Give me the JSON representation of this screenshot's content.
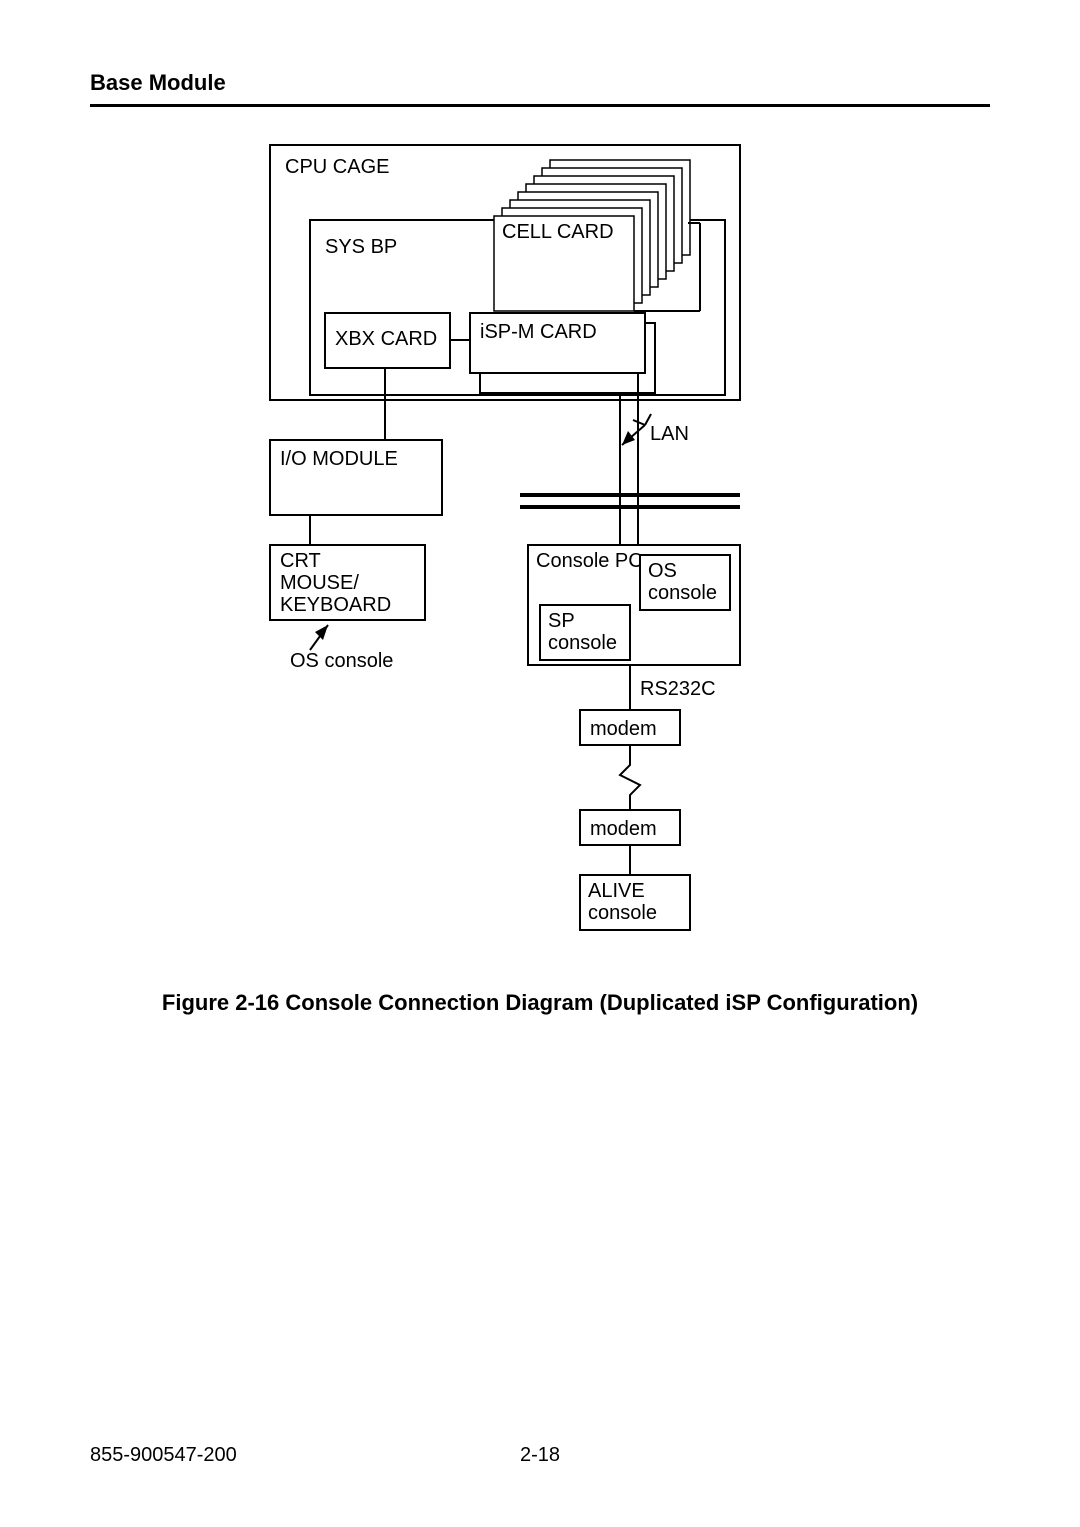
{
  "header": {
    "title": "Base Module"
  },
  "diagram": {
    "labels": {
      "cpu_cage": "CPU CAGE",
      "sys_bp": "SYS BP",
      "cell_card": "CELL CARD",
      "xbx_card": "XBX CARD",
      "isp_m_card": "iSP-M CARD",
      "io_module": "I/O MODULE",
      "lan": "LAN",
      "crt_l1": "CRT",
      "crt_l2": "MOUSE/",
      "crt_l3": "KEYBOARD",
      "os_console_note": "OS console",
      "console_pc": "Console PC",
      "os_l1": "OS",
      "os_l2": "console",
      "sp_l1": "SP",
      "sp_l2": "console",
      "rs232c": "RS232C",
      "modem1": "modem",
      "modem2": "modem",
      "alive_l1": "ALIVE",
      "alive_l2": "console"
    }
  },
  "caption": "Figure 2-16    Console Connection Diagram (Duplicated iSP Configuration)",
  "footer": {
    "doc_number": "855-900547-200",
    "page_number": "2-18"
  }
}
